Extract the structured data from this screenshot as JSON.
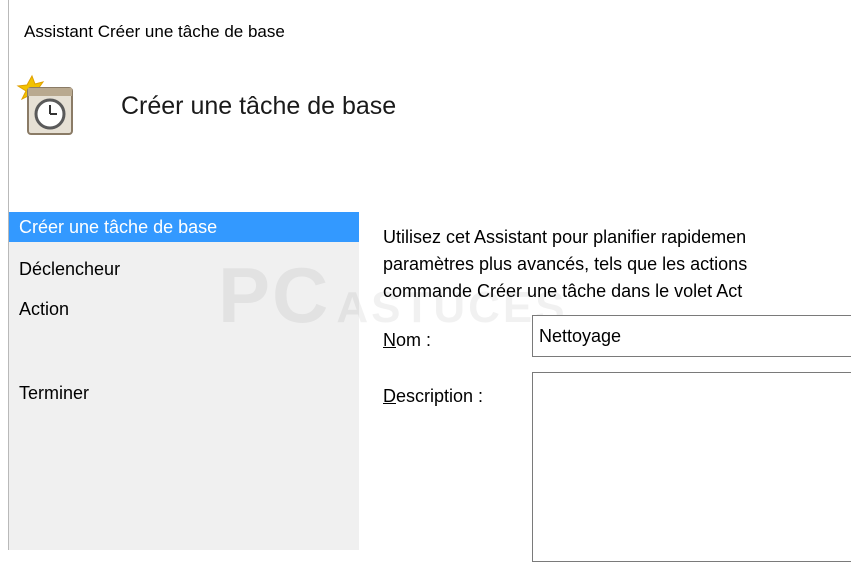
{
  "window": {
    "title": "Assistant Créer une tâche de base"
  },
  "header": {
    "icon": "scheduled-task-clock-icon",
    "title": "Créer une tâche de base"
  },
  "steps": {
    "items": [
      {
        "label": "Créer une tâche de base",
        "selected": true
      },
      {
        "label": "Déclencheur",
        "selected": false
      },
      {
        "label": "Action",
        "selected": false
      },
      {
        "label": "Terminer",
        "selected": false
      }
    ]
  },
  "content": {
    "intro_lines": [
      "Utilisez cet Assistant pour planifier rapidemen",
      "paramètres plus avancés, tels que les actions",
      "commande Créer une tâche dans le volet Act"
    ],
    "name_label_prefix": "N",
    "name_label_rest": "om :",
    "name_value": "Nettoyage",
    "description_label_prefix": "D",
    "description_label_rest": "escription :",
    "description_value": ""
  },
  "watermark": {
    "big": "PC",
    "small": "ASTUCES"
  },
  "colors": {
    "selection": "#3399ff",
    "steps_pane": "#f0f0f0",
    "border": "#7a7a7a"
  }
}
